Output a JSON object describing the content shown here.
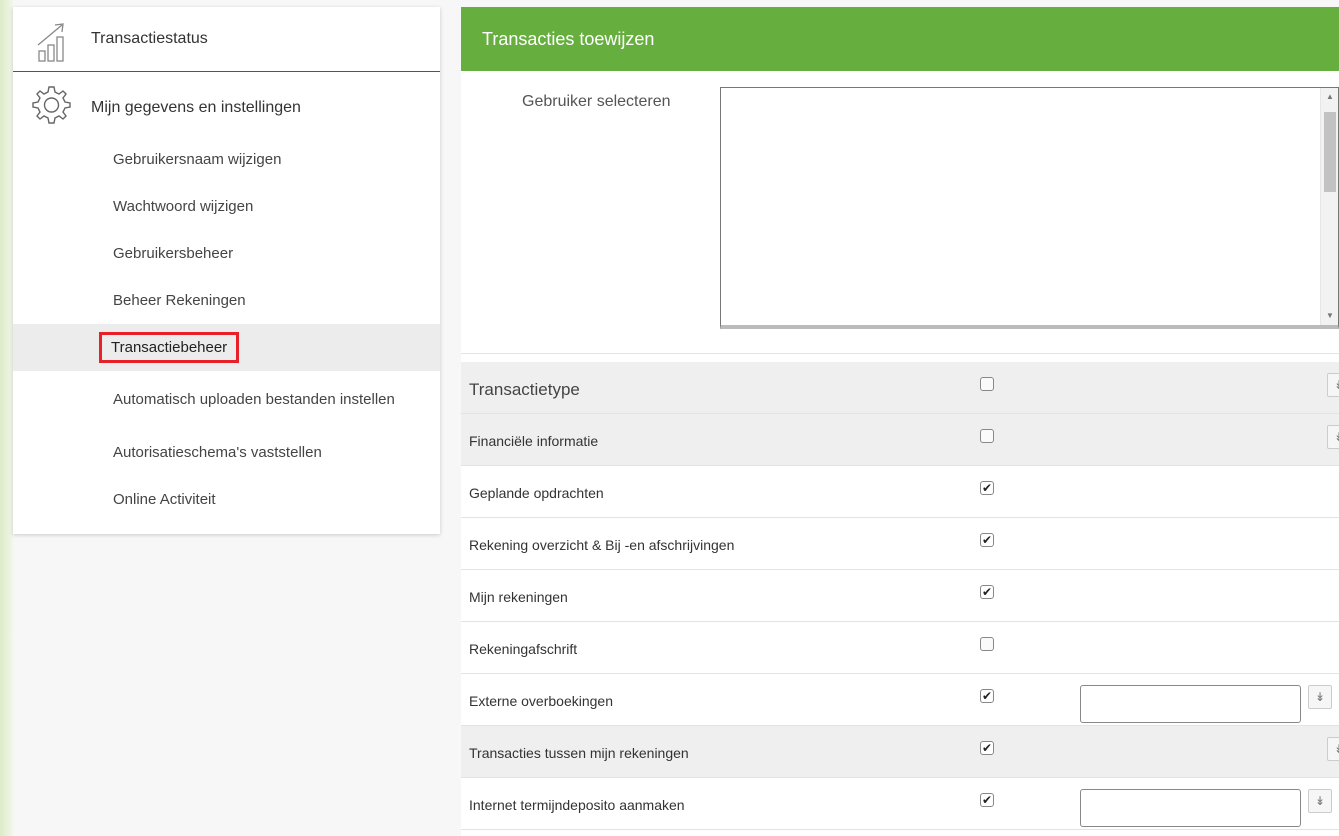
{
  "sidebar": {
    "transaction_status_label": "Transactiestatus",
    "settings_label": "Mijn gegevens en instellingen",
    "items": [
      {
        "label": "Gebruikersnaam wijzigen",
        "active": false
      },
      {
        "label": "Wachtwoord wijzigen",
        "active": false
      },
      {
        "label": "Gebruikersbeheer",
        "active": false
      },
      {
        "label": "Beheer Rekeningen",
        "active": false
      },
      {
        "label": "Transactiebeheer",
        "active": true
      },
      {
        "label": "Automatisch uploaden bestanden instellen",
        "active": false
      },
      {
        "label": "Autorisatieschema's vaststellen",
        "active": false
      },
      {
        "label": "Online Activiteit",
        "active": false
      }
    ]
  },
  "panel": {
    "title": "Transacties toewijzen",
    "user_select_label": "Gebruiker selecteren",
    "accent_color": "#66af3f"
  },
  "rows": [
    {
      "label": "Transactietype",
      "checked": false
    },
    {
      "label": "Financiële informatie",
      "checked": false
    },
    {
      "label": "Geplande opdrachten",
      "checked": true
    },
    {
      "label": "Rekening overzicht & Bij -en afschrijvingen",
      "checked": true
    },
    {
      "label": "Mijn rekeningen",
      "checked": true
    },
    {
      "label": "Rekeningafschrift",
      "checked": false
    },
    {
      "label": "Externe overboekingen",
      "checked": true
    },
    {
      "label": "Transacties tussen mijn rekeningen",
      "checked": true
    },
    {
      "label": "Internet termijndeposito aanmaken",
      "checked": true
    }
  ],
  "icons": {
    "checkmark": "✔",
    "expand": "↡",
    "scroll_up": "▲",
    "scroll_down": "▼"
  }
}
